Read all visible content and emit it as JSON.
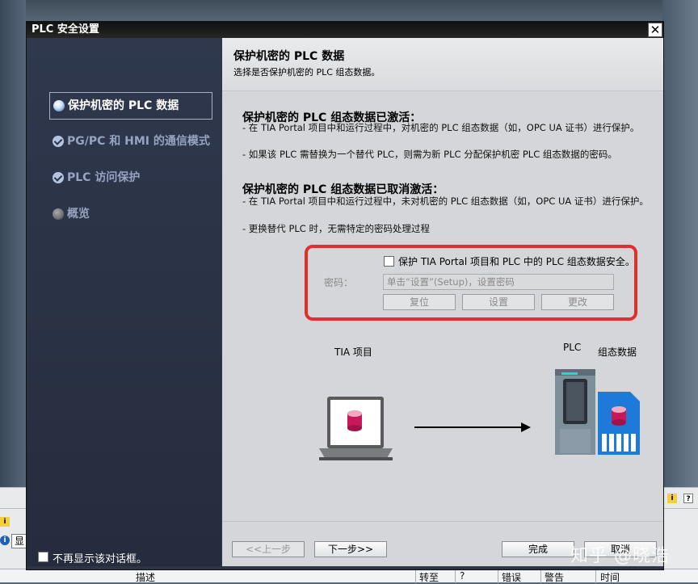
{
  "dialog": {
    "title": "PLC 安全设置",
    "close_glyph": "✕"
  },
  "sidebar": {
    "items": [
      {
        "label": "保护机密的 PLC 数据",
        "state": "active"
      },
      {
        "label": "PG/PC 和 HMI 的通信模式",
        "state": "done"
      },
      {
        "label": "PLC 访问保护",
        "state": "done"
      },
      {
        "label": "概览",
        "state": "pending"
      }
    ],
    "dont_show_label": "不再显示该对话框。"
  },
  "header": {
    "title": "保护机密的 PLC 数据",
    "subtitle": "选择是否保护机密的 PLC 组态数据。"
  },
  "activated": {
    "title": "保护机密的 PLC 组态数据已激活：",
    "line1": "- 在 TIA Portal 项目中和运行过程中，对机密的 PLC 组态数据（如，OPC UA 证书）进行保护。",
    "line2": "- 如果该 PLC 需替换为一个替代 PLC，则需为新 PLC 分配保护机密 PLC 组态数据的密码。"
  },
  "deactivated": {
    "title": "保护机密的 PLC 组态数据已取消激活：",
    "line1": "- 在 TIA Portal 项目中和运行过程中，未对机密的 PLC 组态数据（如，OPC UA 证书）进行保护。",
    "line2": "- 更换替代 PLC 时，无需特定的密码处理过程"
  },
  "protection": {
    "checkbox_label": "保护 TIA Portal 项目和 PLC 中的 PLC 组态数据安全。",
    "password_label": "密码：",
    "password_placeholder": "单击“设置”(Setup)，设置密码",
    "reset_label": "复位",
    "set_label": "设置",
    "change_label": "更改"
  },
  "diagram": {
    "tia_label": "TIA 项目",
    "plc_label": "PLC",
    "config_label": "组态数据"
  },
  "footer": {
    "prev_label": "<<上一步",
    "next_label": "下一步>>",
    "finish_label": "完成",
    "cancel_label": "取消"
  },
  "background": {
    "status_columns": [
      "描述",
      "转至",
      "?",
      "错误",
      "警告",
      "时间"
    ],
    "side_char": "显",
    "info_glyph": "i"
  },
  "watermark": "知乎 @晓浩",
  "colors": {
    "sidebar_bg": "#2d3446",
    "content_bg": "#d4d6d9",
    "highlight_frame": "#e0302b"
  }
}
